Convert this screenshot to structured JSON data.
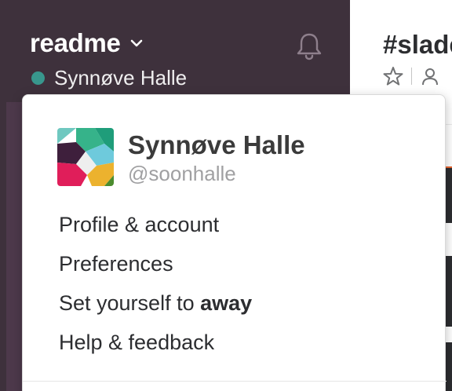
{
  "sidebar": {
    "team_name": "readme",
    "current_user": "Synnøve Halle",
    "icons": {
      "team_dropdown": "chevron-down-icon",
      "notifications": "bell-icon",
      "presence": "presence-dot"
    },
    "colors": {
      "sidebar_bg": "#4d394b",
      "header_bg": "#3e313c",
      "presence": "#38978d"
    }
  },
  "channel": {
    "name": "#slade",
    "icons": [
      "star-icon",
      "user-icon"
    ]
  },
  "menu": {
    "user": {
      "full_name": "Synnøve Halle",
      "handle": "@soonhalle",
      "avatar": "avatar-image"
    },
    "items": [
      {
        "label": "Profile & account"
      },
      {
        "label": "Preferences"
      },
      {
        "label_prefix": "Set yourself to ",
        "label_bold": "away"
      },
      {
        "label": "Help & feedback"
      }
    ]
  }
}
